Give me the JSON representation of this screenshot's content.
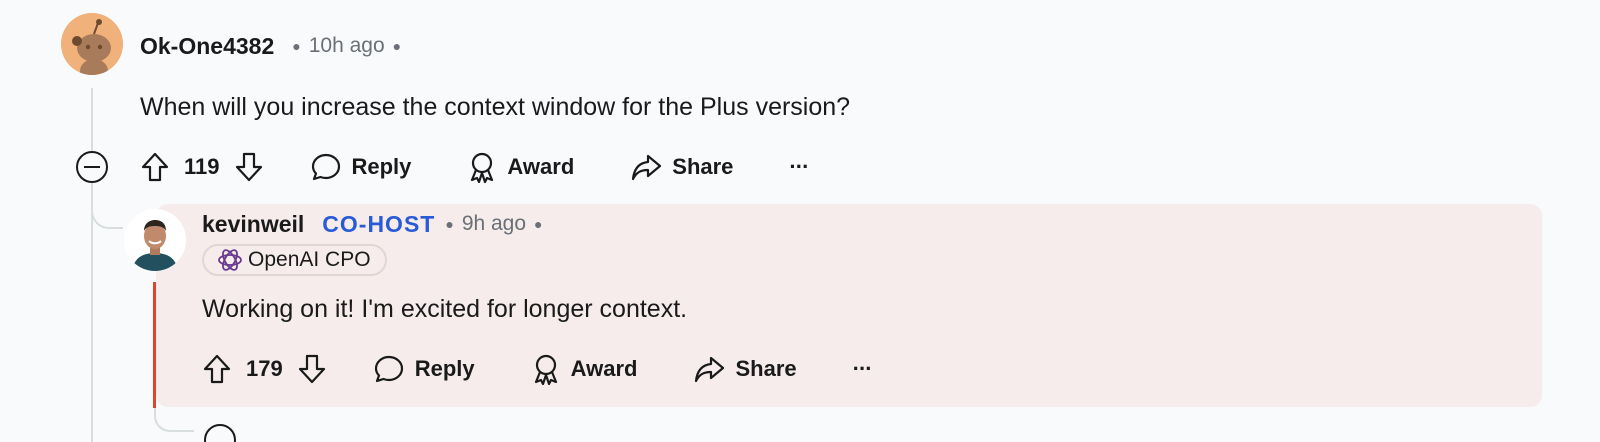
{
  "comment": {
    "username": "Ok-One4382",
    "time": "10h ago",
    "body": "When will you increase the context window for the Plus version?",
    "votes": "119",
    "actions": {
      "reply": "Reply",
      "award": "Award",
      "share": "Share",
      "more": "···"
    }
  },
  "reply": {
    "username": "kevinweil",
    "badge": "CO-HOST",
    "time": "9h ago",
    "flair": "OpenAI CPO",
    "body": "Working on it! I'm excited for longer context.",
    "votes": "179",
    "actions": {
      "reply": "Reply",
      "award": "Award",
      "share": "Share",
      "more": "···"
    }
  },
  "colors": {
    "background": "#f9fafb",
    "reply_highlight": "#f5eceb",
    "cohost_badge": "#2a5bd7",
    "op_accent_line": "#e0452b",
    "avatar_orange": "#f0b27a"
  },
  "icons": [
    "reddit-avatar-icon",
    "collapse-icon",
    "upvote-icon",
    "downvote-icon",
    "comment-icon",
    "award-icon",
    "share-icon",
    "more-icon",
    "openai-logo-icon"
  ]
}
